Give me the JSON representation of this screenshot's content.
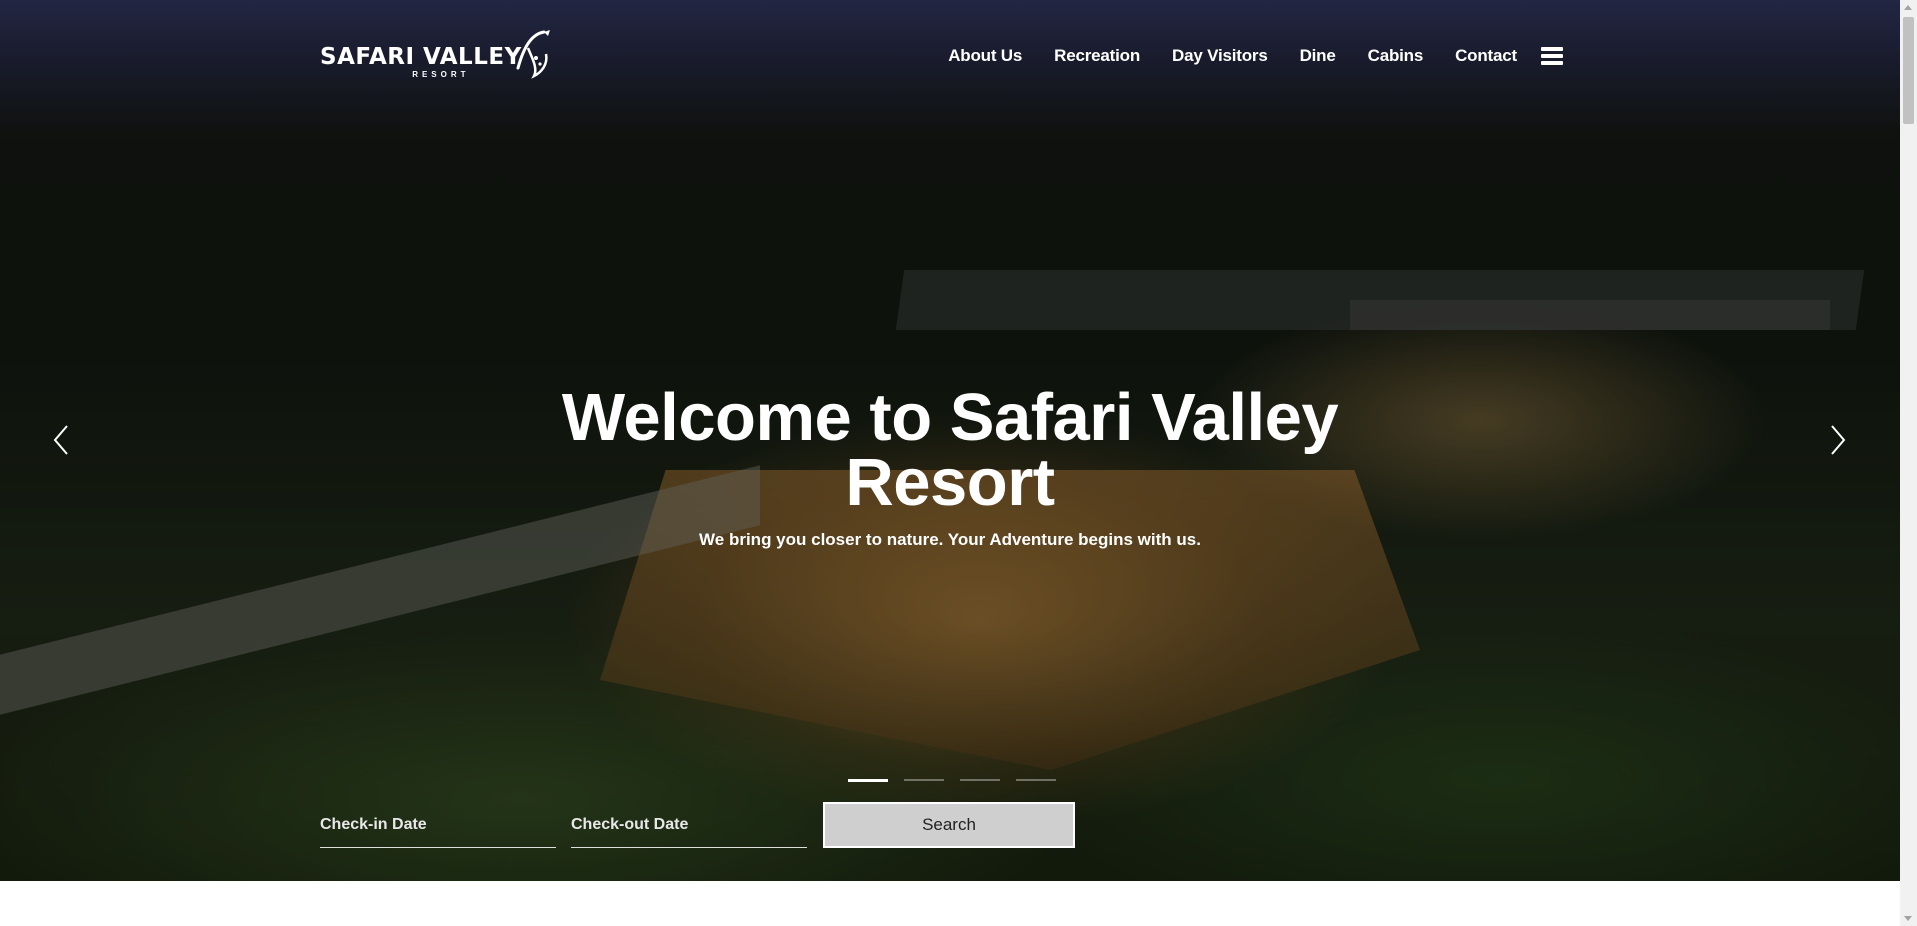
{
  "header": {
    "logo": {
      "main": "SAFARI VALLEY",
      "sub": "RESORT"
    },
    "nav": [
      {
        "label": "About Us"
      },
      {
        "label": "Recreation"
      },
      {
        "label": "Day Visitors"
      },
      {
        "label": "Dine"
      },
      {
        "label": "Cabins"
      },
      {
        "label": "Contact"
      }
    ],
    "menu_icon": "hamburger-menu-icon"
  },
  "hero": {
    "title_line1": "Welcome to Safari Valley",
    "title_line2": "Resort",
    "subtitle": "We bring you closer to nature. Your Adventure begins with us.",
    "prev_icon": "chevron-left-icon",
    "next_icon": "chevron-right-icon",
    "slides_count": 4,
    "active_slide": 1
  },
  "booking": {
    "checkin_placeholder": "Check-in Date",
    "checkout_placeholder": "Check-out Date",
    "search_label": "Search"
  },
  "colors": {
    "text": "#ffffff",
    "button_bg": "#cfcfcf",
    "button_text": "#222222"
  }
}
